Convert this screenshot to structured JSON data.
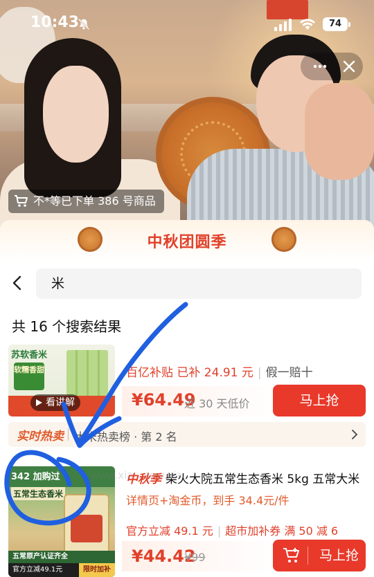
{
  "status_bar": {
    "time": "10:43",
    "battery": "74"
  },
  "live": {
    "order_toast": "不*等已下单 386 号商品"
  },
  "panel": {
    "title": "中秋团圆季",
    "search": {
      "query": "米"
    },
    "results_count": "共 16 个搜索结果"
  },
  "products": [
    {
      "image_tag": "苏软香米",
      "image_sticker": "软糯香甜",
      "explain_chip": "看讲解",
      "subsidy": "百亿补贴",
      "subsidy_amount": "已补 24.91 元",
      "guarantee": "假一赔十",
      "price": "¥64.49",
      "price_note": "近 30 天低价",
      "buy_label": "马上抢",
      "rank_tag": "实时热卖",
      "rank_text": "大米热卖榜 · 第 2 名"
    },
    {
      "image_badge": "342 加购过",
      "image_name": "五常生态香米",
      "image_bottom1": "五常原产认证齐全",
      "image_bottom2_left": "官方立减49.1元",
      "image_bottom2_right": "限时加补",
      "brand": "中秋季",
      "title": "柴火大院五常生态香米 5kg 五常大米",
      "sub": "详情页+淘金币，到手 34.4元/件",
      "promo1": "官方立减 49.1 元",
      "promo2": "超市加补券",
      "promo3": "满 50 减 6",
      "price": "¥44.42",
      "old_price": "¥99",
      "buy_label": "马上抢"
    }
  ],
  "watermark": "www.xia...new.xia...",
  "colors": {
    "accent": "#e8392b",
    "annotation": "#1f5fe0"
  }
}
